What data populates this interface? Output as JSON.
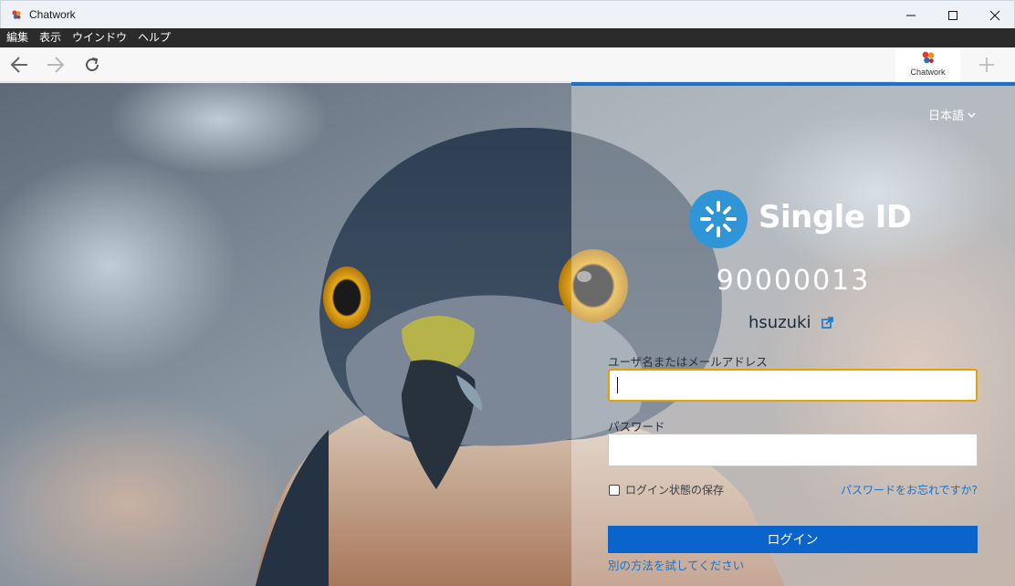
{
  "window": {
    "title": "Chatwork",
    "controls": {
      "minimize": "minimize-icon",
      "maximize": "maximize-icon",
      "close": "close-icon"
    }
  },
  "menu": {
    "items": [
      "編集",
      "表示",
      "ウインドウ",
      "ヘルプ"
    ]
  },
  "nav": {
    "back_icon": "arrow-left-icon",
    "forward_icon": "arrow-right-icon",
    "reload_icon": "reload-icon",
    "new_tab_icon": "plus-icon"
  },
  "tabs": [
    {
      "label": "Chatwork",
      "icon": "chatwork-logo-icon",
      "active": true
    }
  ],
  "login": {
    "language": "日本語",
    "brand": "Single ID",
    "org_id": "90000013",
    "username": "hsuzuki",
    "username_label": "ユーザ名またはメールアドレス",
    "username_value": "",
    "password_label": "パスワード",
    "password_value": "",
    "remember_label": "ログイン状態の保存",
    "remember_checked": false,
    "forgot_link": "パスワードをお忘れですか?",
    "login_button": "ログイン",
    "alt_method_link": "別の方法を試してください"
  },
  "colors": {
    "accent_blue": "#0a64cc",
    "link_blue": "#1a73c9",
    "focus_border": "#e0a400",
    "brand_circle": "#2f95d6",
    "menubar_bg": "#2b2b2b"
  }
}
